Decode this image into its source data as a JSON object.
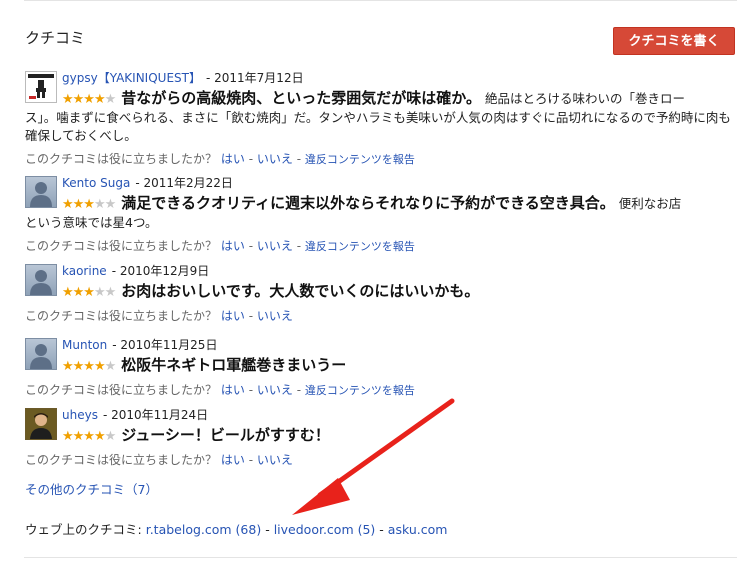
{
  "section": {
    "title": "クチコミ",
    "write_button": "クチコミを書く"
  },
  "helpful": {
    "question": "このクチコミは役に立ちましたか？",
    "yes": "はい",
    "no": "いいえ",
    "dash": "-",
    "report": "違反コンテンツを報告"
  },
  "reviews": [
    {
      "author": "gypsy【YAKINIQUEST】",
      "date": "- 2011年7月12日",
      "rating": 4,
      "title": "昔ながらの高級焼肉、といった雰囲気だが味は確か。",
      "snippet": "絶品はとろける味わいの「巻きロー",
      "body": "ス」。噛まずに食べられる、まさに「飲む焼肉」だ。タンやハラミも美味いが人気の肉はすぐに品切れになるので予約時に肉も確保しておくべし。",
      "avatar": "yakiniquest-logo"
    },
    {
      "author": "Kento Suga",
      "date": "- 2011年2月22日",
      "rating": 3,
      "title": "満足できるクオリティに週末以外ならそれなりに予約ができる空き具合。",
      "snippet": "便利なお店",
      "body": "という意味では星4つ。",
      "avatar": "default-avatar"
    },
    {
      "author": "kaorine",
      "date": "- 2010年12月9日",
      "rating": 3,
      "title": "お肉はおいしいです。大人数でいくのにはいいかも。",
      "snippet": "",
      "body": "",
      "avatar": "default-avatar"
    },
    {
      "author": "Munton",
      "date": "- 2010年11月25日",
      "rating": 4,
      "title": "松阪牛ネギトロ軍艦巻きまいうー",
      "snippet": "",
      "body": "",
      "avatar": "default-avatar"
    },
    {
      "author": "uheys",
      "date": "- 2010年11月24日",
      "rating": 4,
      "title": "ジューシー！ビールがすすむ！",
      "snippet": "",
      "body": "",
      "avatar": "photo-avatar"
    }
  ],
  "more_reviews": "その他のクチコミ（7）",
  "web_reviews": {
    "label": "ウェブ上のクチコミ:",
    "sources": [
      "r.tabelog.com (68)",
      "livedoor.com (5)",
      "asku.com"
    ],
    "separator": "-"
  },
  "colors": {
    "accent_button": "#d64937",
    "link": "#2754b4",
    "star_on": "#f0a000",
    "star_off": "#c8c8c8",
    "arrow": "#e8221b"
  }
}
